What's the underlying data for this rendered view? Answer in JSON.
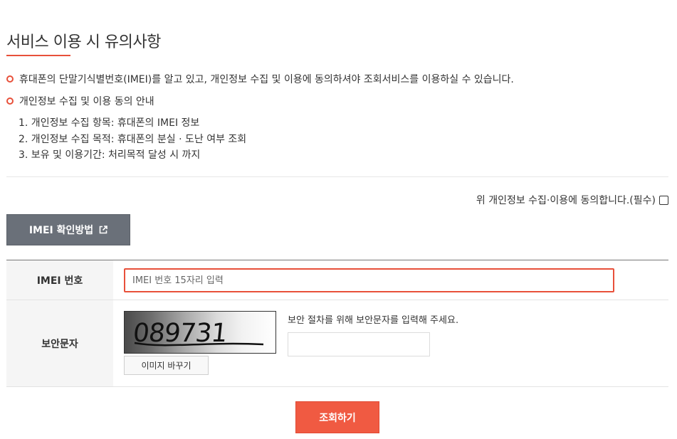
{
  "page": {
    "title": "서비스 이용 시 유의사항"
  },
  "notices": [
    "휴대폰의 단말기식별번호(IMEI)를 알고 있고, 개인정보 수집 및 이용에 동의하셔야 조회서비스를 이용하실 수 있습니다.",
    "개인정보 수집 및 이용 동의 안내"
  ],
  "privacy_items": [
    "1. 개인정보 수집 항목: 휴대폰의 IMEI 정보",
    "2. 개인정보 수집 목적: 휴대폰의 분실 · 도난 여부 조회",
    "3. 보유 및 이용기간: 처리목적 달성 시 까지"
  ],
  "agreement": {
    "label": "위 개인정보 수집·이용에 동의합니다.(필수)",
    "checked": false
  },
  "imei_guide_button": {
    "label": "IMEI 확인방법",
    "icon": "external-link-icon"
  },
  "form": {
    "imei_label": "IMEI 번호",
    "imei_placeholder": "IMEI 번호 15자리 입력",
    "imei_value": "",
    "security_label": "보안문자",
    "captcha_text": "089731",
    "refresh_label": "이미지 바꾸기",
    "security_hint": "보안 절차를 위해 보안문자를 입력해 주세요.",
    "security_value": ""
  },
  "submit_label": "조회하기",
  "colors": {
    "accent": "#e8503a",
    "submit_bg": "#f05a42",
    "guide_button_bg": "#6a7079",
    "label_bg": "#f5f5f5"
  }
}
